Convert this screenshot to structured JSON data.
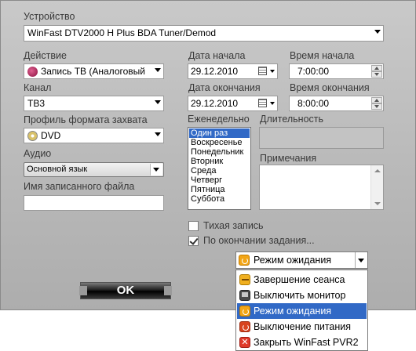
{
  "device": {
    "label": "Устройство",
    "value": "WinFast DTV2000 H Plus BDA Tuner/Demod"
  },
  "action": {
    "label": "Действие",
    "value": "Запись ТВ (Аналоговый"
  },
  "channel": {
    "label": "Канал",
    "value": "ТВ3"
  },
  "capture_profile": {
    "label": "Профиль формата захвата",
    "value": "DVD"
  },
  "audio": {
    "label": "Аудио",
    "value": "Основной язык"
  },
  "filename": {
    "label": "Имя записанного файла",
    "value": ""
  },
  "start_date": {
    "label": "Дата начала",
    "value": "29.12.2010"
  },
  "start_time": {
    "label": "Время начала",
    "value": "7:00:00"
  },
  "end_date": {
    "label": "Дата окончания",
    "value": "29.12.2010"
  },
  "end_time": {
    "label": "Время окончания",
    "value": "8:00:00"
  },
  "weekly": {
    "label": "Еженедельно",
    "items": [
      "Один раз",
      "Воскресенье",
      "Понедельник",
      "Вторник",
      "Среда",
      "Четверг",
      "Пятница",
      "Суббота"
    ],
    "selected_index": 0
  },
  "duration": {
    "label": "Длительность",
    "value": ""
  },
  "notes": {
    "label": "Примечания",
    "value": ""
  },
  "silent_record": {
    "label": "Тихая запись",
    "checked": false
  },
  "on_finish": {
    "label": "По окончании задания...",
    "checked": true
  },
  "after_action": {
    "value": "Режим ожидания",
    "options": [
      {
        "label": "Завершение сеанса",
        "icon": "key-icon"
      },
      {
        "label": "Выключить монитор",
        "icon": "monitor-icon"
      },
      {
        "label": "Режим ожидания",
        "icon": "standby-icon",
        "selected": true
      },
      {
        "label": "Выключение питания",
        "icon": "power-off-icon"
      },
      {
        "label": "Закрыть WinFast PVR2",
        "icon": "close-app-icon"
      }
    ]
  },
  "ok_button": {
    "label": "OK"
  }
}
